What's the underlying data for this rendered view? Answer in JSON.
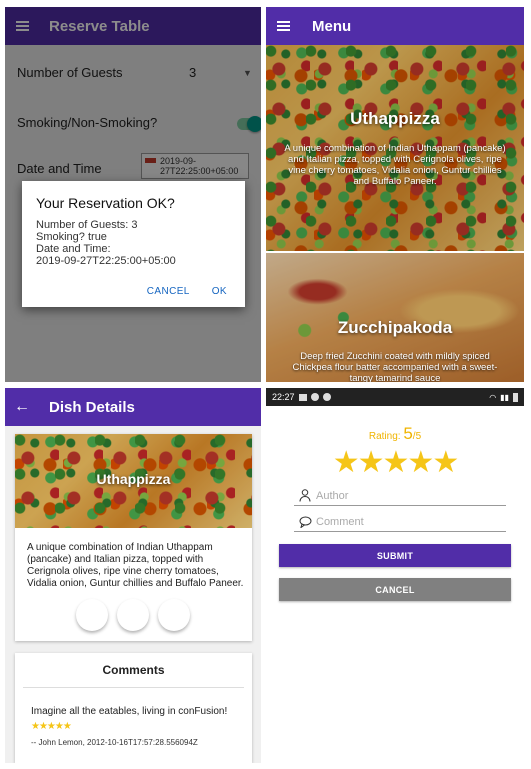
{
  "reserve": {
    "title": "Reserve Table",
    "guests_label": "Number of Guests",
    "guests_value": "3",
    "smoking_label": "Smoking/Non-Smoking?",
    "smoking_on": true,
    "date_label": "Date and Time",
    "date_value_line1": "2019-09-",
    "date_value_line2": "27T22:25:00+05:00",
    "dialog": {
      "title": "Your Reservation OK?",
      "line1": "Number of Guests: 3",
      "line2": "Smoking? true",
      "line3": "Date and Time:",
      "line4": "2019-09-27T22:25:00+05:00",
      "cancel": "CANCEL",
      "ok": "OK"
    }
  },
  "menu": {
    "title": "Menu",
    "items": [
      {
        "name": "Uthappizza",
        "description": "A unique combination of Indian Uthappam (pancake) and Italian pizza, topped with Cerignola olives, ripe vine cherry tomatoes, Vidalia onion, Guntur chillies and Buffalo Paneer."
      },
      {
        "name": "Zucchipakoda",
        "description": "Deep fried Zucchini coated with mildly spiced Chickpea flour batter accompanied with a sweet-tangy tamarind sauce"
      }
    ]
  },
  "dishdetail": {
    "title": "Dish Details",
    "dish_name": "Uthappizza",
    "dish_description": "A unique combination of Indian Uthappam (pancake) and Italian pizza, topped with Cerignola olives, ripe vine cherry tomatoes, Vidalia onion, Guntur chillies and Buffalo Paneer.",
    "comments_title": "Comments",
    "comment": {
      "text": "Imagine all the eatables, living in conFusion!",
      "stars": "★★★★★",
      "meta": "-- John Lemon, 2012-10-16T17:57:28.556094Z"
    },
    "fab_colors": {
      "favorite": "#f4511e",
      "edit": "#1a0dd6",
      "share": "#4ecdaa"
    }
  },
  "commentform": {
    "status_time": "22:27",
    "rating_label": "Rating:",
    "rating_value": "5",
    "rating_max": "/5",
    "rating_stars": "★★★★★",
    "author_placeholder": "Author",
    "comment_placeholder": "Comment",
    "submit_label": "SUBMIT",
    "cancel_label": "CANCEL"
  },
  "colors": {
    "primary": "#512da8",
    "accent": "#009688",
    "star": "#f5c518",
    "cancel_button": "#808080"
  }
}
